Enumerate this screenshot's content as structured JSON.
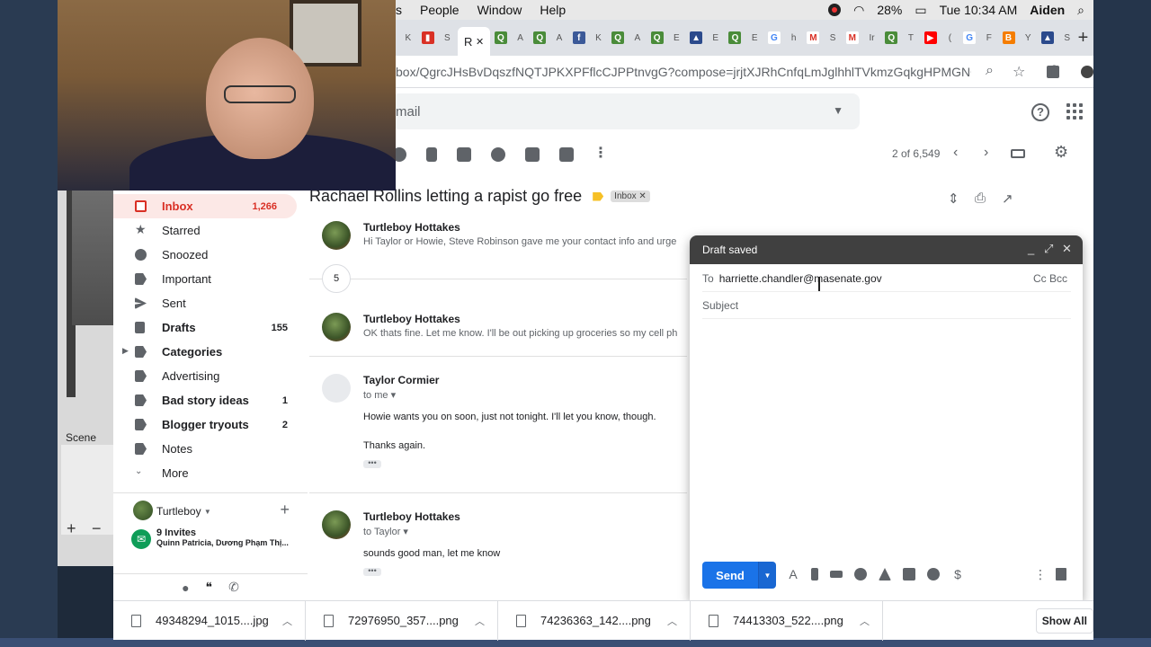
{
  "menubar": {
    "items": [
      "s",
      "People",
      "Window",
      "Help"
    ],
    "battery": "28%",
    "clock": "Tue 10:34 AM",
    "user": "Aiden"
  },
  "tabs": {
    "active_label": "R",
    "letters": [
      "K",
      "S",
      "A",
      "A",
      "K",
      "A",
      "E",
      "E",
      "E",
      "h",
      "S",
      "Ir",
      "T",
      "(",
      "F",
      "Y",
      "S"
    ]
  },
  "address": {
    "url": "box/QgrcJHsBvDqszfNQTJPKXPFflcCJPPtnvgG?compose=jrjtXJRhCnfqLmJglhhlTVkmzGqkgHPMGNQn..."
  },
  "gmail": {
    "search_placeholder": "mail",
    "pager": "2 of 6,549",
    "sidebar": [
      {
        "label": "Inbox",
        "count": "1,266"
      },
      {
        "label": "Starred",
        "count": ""
      },
      {
        "label": "Snoozed",
        "count": ""
      },
      {
        "label": "Important",
        "count": ""
      },
      {
        "label": "Sent",
        "count": ""
      },
      {
        "label": "Drafts",
        "count": "155"
      },
      {
        "label": "Categories",
        "count": ""
      },
      {
        "label": "Advertising",
        "count": ""
      },
      {
        "label": "Bad story ideas",
        "count": "1"
      },
      {
        "label": "Blogger tryouts",
        "count": "2"
      },
      {
        "label": "Notes",
        "count": ""
      },
      {
        "label": "More",
        "count": ""
      }
    ],
    "hangouts": {
      "user": "Turtleboy",
      "invites_title": "9 Invites",
      "invites_names": "Quinn Patricia, Dương Phạm Thị..."
    },
    "thread": {
      "subject": "Rachael Rollins letting a rapist go free",
      "chip": "Inbox",
      "collapsed_count": "5",
      "messages": [
        {
          "sender": "Turtleboy Hottakes",
          "snippet": "Hi Taylor or Howie, Steve Robinson gave me your contact info and urge"
        },
        {
          "sender": "Turtleboy Hottakes",
          "snippet": "OK thats fine. Let me know. I'll be out picking up groceries so my cell ph"
        },
        {
          "sender": "Taylor Cormier",
          "to": "to me",
          "body1": "Howie wants you on soon, just not tonight. I'll let you know, though.",
          "body2": "Thanks again."
        },
        {
          "sender": "Turtleboy Hottakes",
          "to": "to Taylor",
          "body1": "sounds good man, let me know"
        }
      ]
    },
    "compose": {
      "title": "Draft saved",
      "to_label": "To",
      "to_value": "harriette.chandler@masenate.gov",
      "ccbcc": "Cc Bcc",
      "subject_placeholder": "Subject",
      "send": "Send"
    }
  },
  "left_app": {
    "scene_label": "Scene"
  },
  "downloads": {
    "items": [
      "49348294_1015....jpg",
      "72976950_357....png",
      "74236363_142....png",
      "74413303_522....png"
    ],
    "show_all": "Show All"
  }
}
